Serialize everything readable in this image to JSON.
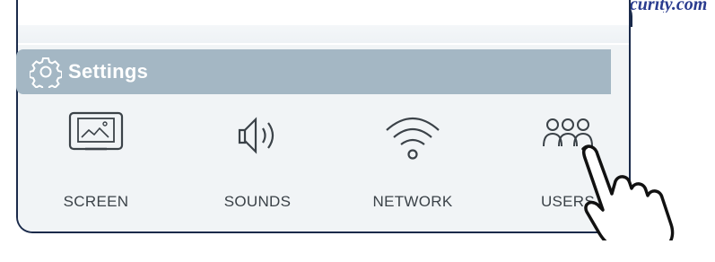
{
  "logo": {
    "text": "www.ITP-security.com"
  },
  "header": {
    "title": "Settings",
    "icon": "gear-icon"
  },
  "tiles": [
    {
      "label": "SCREEN",
      "icon": "screen-icon"
    },
    {
      "label": "SOUNDS",
      "icon": "speaker-icon"
    },
    {
      "label": "NETWORK",
      "icon": "wifi-icon"
    },
    {
      "label": "USERS",
      "icon": "users-icon"
    }
  ],
  "colors": {
    "header_bg": "#a4b7c4",
    "frame": "#1a2a4a",
    "text": "#3b4248"
  }
}
